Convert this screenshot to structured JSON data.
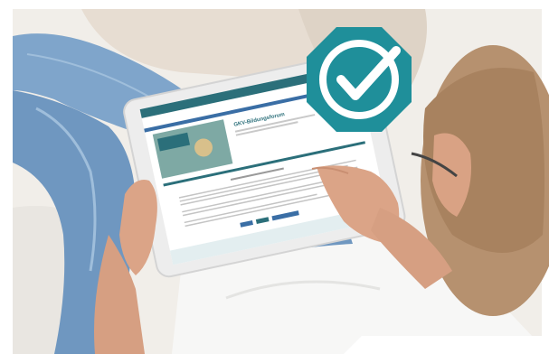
{
  "photo": {
    "subject": "Person on a sofa holding a tablet showing a website",
    "colors": {
      "background": "#f1eee9",
      "jeans": "#6f9ac2",
      "shirt": "#f6f6f5",
      "skin": "#d9a284",
      "hair": "#b48e6d",
      "badge": "#1f8f9a",
      "check": "#ffffff",
      "tablet_frame": "#eeeeee",
      "screen_header": "#2b6f7a",
      "screen_accent": "#3a6ea5"
    }
  },
  "badge": {
    "icon": "checkmark-icon"
  },
  "tablet_screen": {
    "site_title": "GKV-Bildungsforum"
  }
}
